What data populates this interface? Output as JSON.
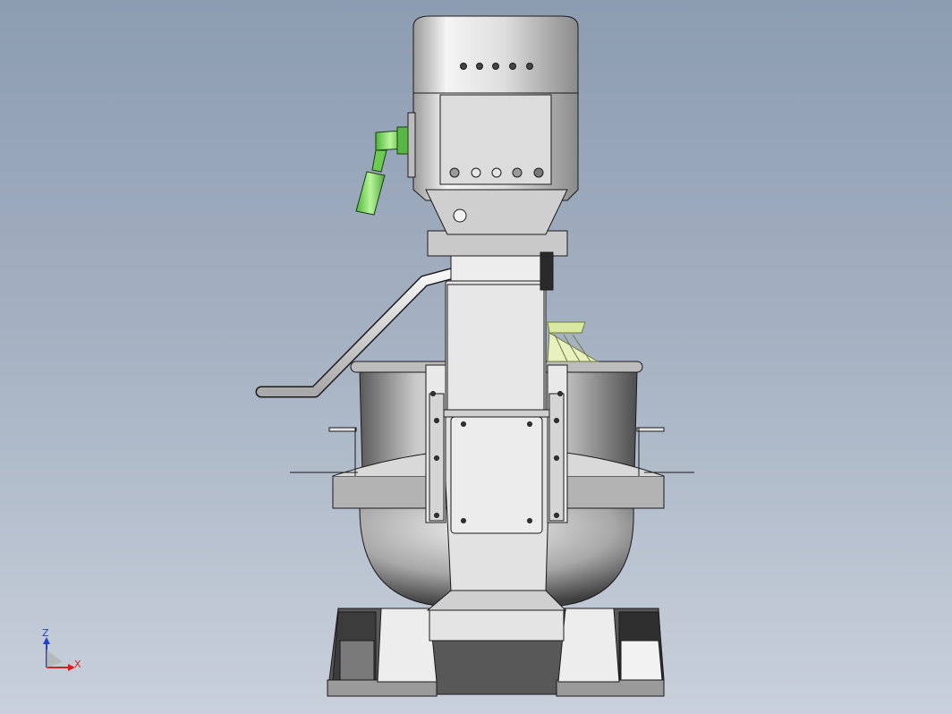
{
  "viewport": {
    "background_top": "#8c9cb1",
    "background_bottom": "#c9d0db"
  },
  "model": {
    "metal_color": "#d6d6d6",
    "outline_color": "#1a1a1a",
    "handle_color": "#7ddc5a",
    "whisk_color": "#d9e8a0"
  },
  "triad": {
    "z_label": "Z",
    "x_label": "X",
    "z_color": "#1f3fd6",
    "x_color": "#d62020"
  }
}
